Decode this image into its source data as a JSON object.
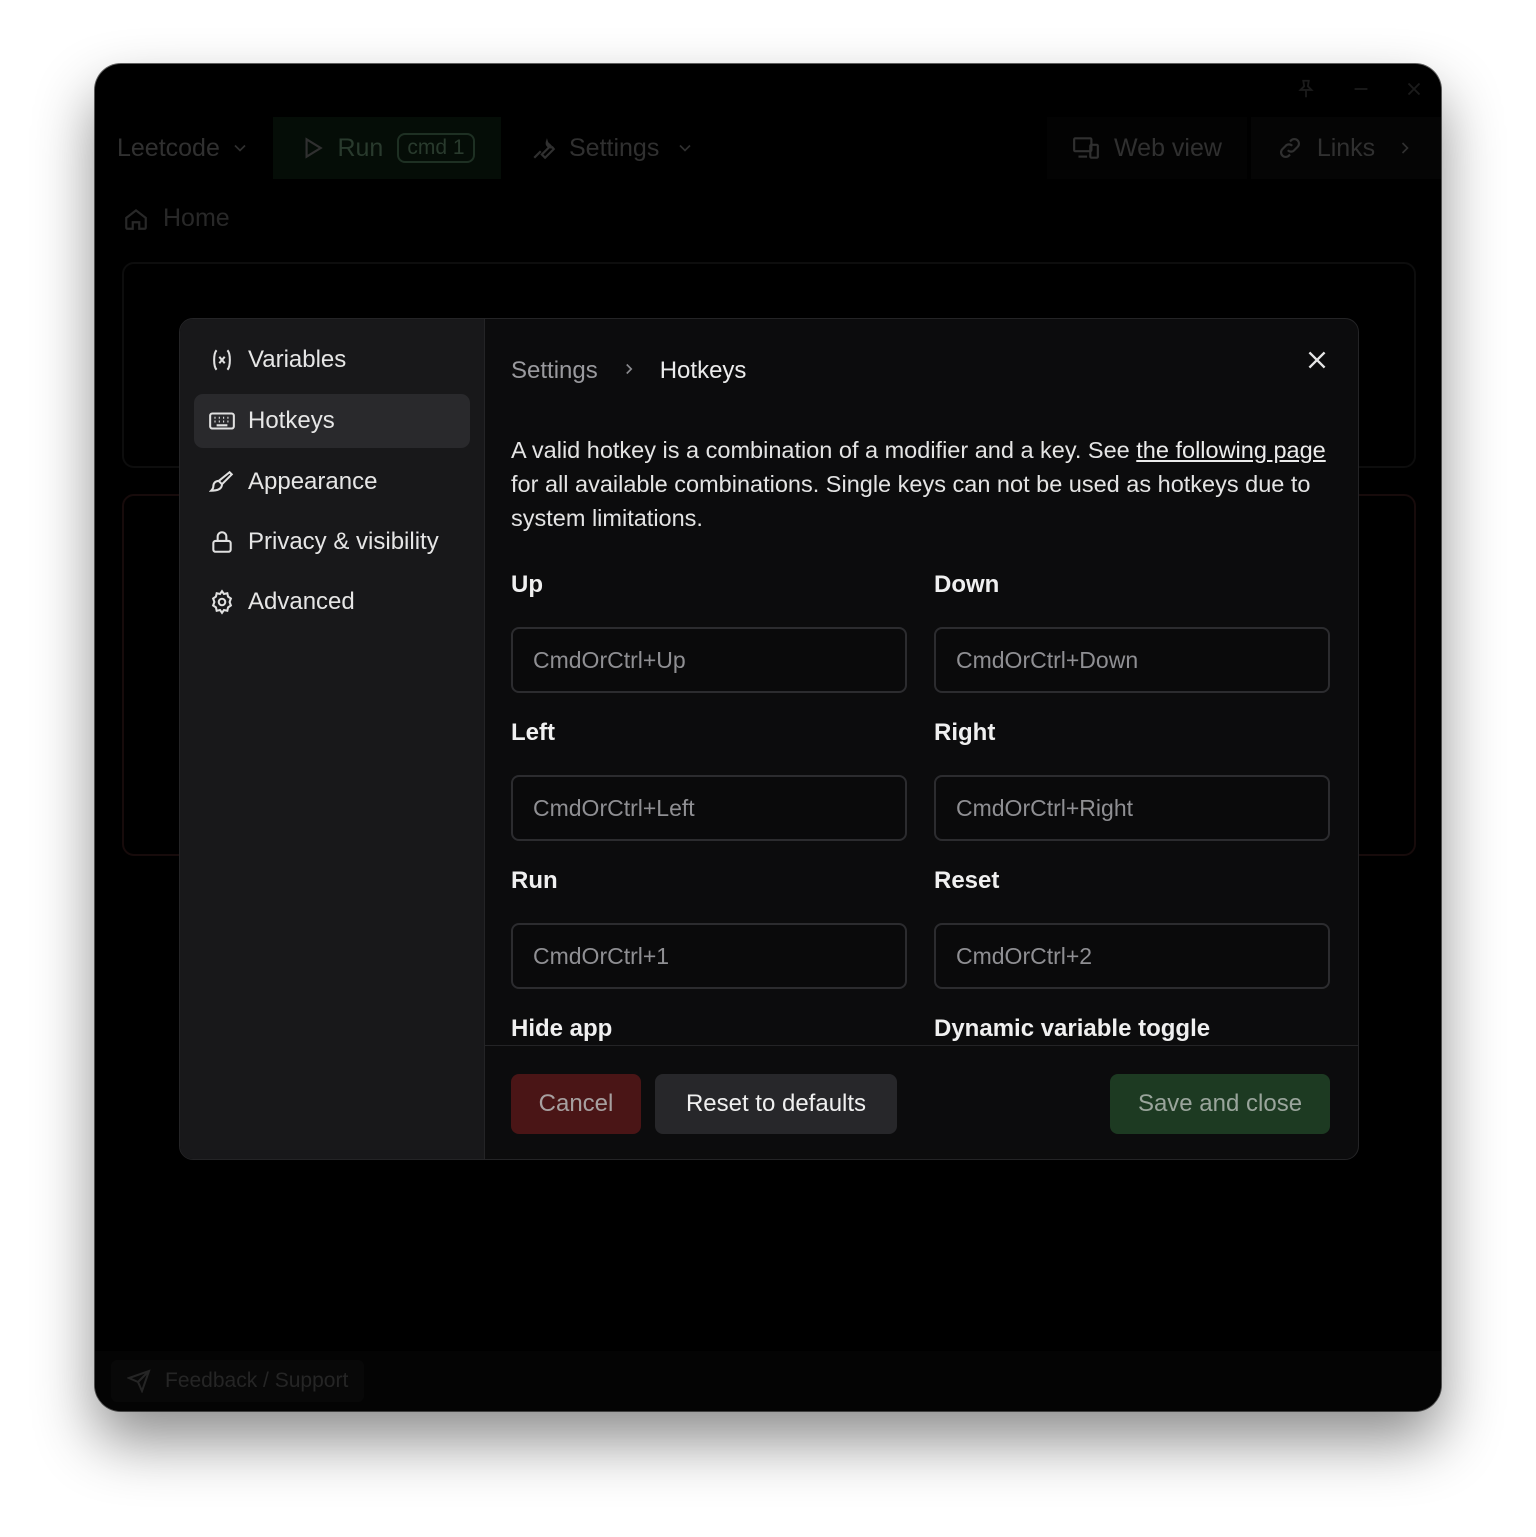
{
  "app": {
    "workspace_label": "Leetcode",
    "run_label": "Run",
    "run_shortcut": "cmd 1",
    "settings_label": "Settings",
    "webview_label": "Web view",
    "links_label": "Links",
    "home_label": "Home",
    "feedback_label": "Feedback / Support"
  },
  "sidebar": {
    "items": [
      {
        "label": "Variables",
        "icon": "variable-icon"
      },
      {
        "label": "Hotkeys",
        "icon": "keyboard-icon",
        "active": true
      },
      {
        "label": "Appearance",
        "icon": "paintbrush-icon"
      },
      {
        "label": "Privacy & visibility",
        "icon": "lock-icon"
      },
      {
        "label": "Advanced",
        "icon": "gear-icon"
      }
    ]
  },
  "breadcrumb": {
    "parent": "Settings",
    "current": "Hotkeys"
  },
  "description": {
    "before_link": "A valid hotkey is a combination of a modifier and a key. See ",
    "link_text": "the following page",
    "after_link": " for all available combinations. Single keys can not be used as hotkeys due to system limitations."
  },
  "fields": {
    "up": {
      "label": "Up",
      "placeholder": "CmdOrCtrl+Up"
    },
    "down": {
      "label": "Down",
      "placeholder": "CmdOrCtrl+Down"
    },
    "left": {
      "label": "Left",
      "placeholder": "CmdOrCtrl+Left"
    },
    "right": {
      "label": "Right",
      "placeholder": "CmdOrCtrl+Right"
    },
    "run": {
      "label": "Run",
      "placeholder": "CmdOrCtrl+1"
    },
    "reset": {
      "label": "Reset",
      "placeholder": "CmdOrCtrl+2"
    },
    "hide_app": {
      "label": "Hide app"
    },
    "dynamic_toggle": {
      "label": "Dynamic variable toggle"
    }
  },
  "buttons": {
    "cancel": "Cancel",
    "reset": "Reset to defaults",
    "save": "Save and close"
  },
  "colors": {
    "cancel_bg": "#4a1516",
    "save_bg": "#1d3a22",
    "active_nav_bg": "#29292c"
  }
}
